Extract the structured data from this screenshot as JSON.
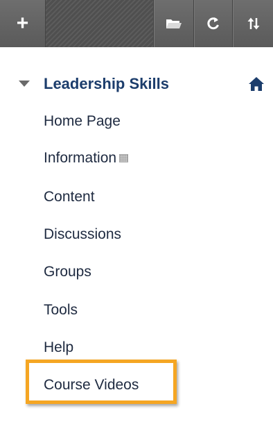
{
  "toolbar": {
    "add_icon": "plus-icon",
    "folder_icon": "folder-icon",
    "refresh_icon": "refresh-icon",
    "sort_icon": "sort-icon"
  },
  "course": {
    "title": "Leadership Skills",
    "expand_icon": "triangle-down-icon",
    "home_icon": "home-icon"
  },
  "menu": {
    "items": [
      {
        "label": "Home Page"
      },
      {
        "label": "Information",
        "badge_icon": "hidden-badge-icon"
      },
      {
        "label": "Content"
      },
      {
        "label": "Discussions"
      },
      {
        "label": "Groups"
      },
      {
        "label": "Tools"
      },
      {
        "label": "Help"
      },
      {
        "label": "Course Videos",
        "highlighted": true
      }
    ]
  },
  "colors": {
    "toolbar_bg": "#5f5f5f",
    "title": "#1c3d6c",
    "menu_text": "#1e2a40",
    "highlight": "#f5a623"
  }
}
